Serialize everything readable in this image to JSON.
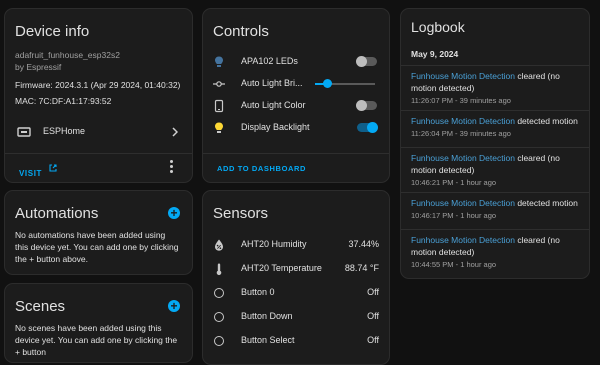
{
  "device": {
    "title": "Device info",
    "model": "adafruit_funhouse_esp32s2",
    "manufacturer": "by Espressif",
    "firmware": "Firmware: 2024.3.1 (Apr 29 2024, 01:40:32)",
    "mac": "MAC: 7C:DF:A1:17:93:52",
    "integration": "ESPHome",
    "visit_label": "VISIT"
  },
  "automations": {
    "title": "Automations",
    "empty_text": "No automations have been added using this device yet. You can add one by clicking the + button above."
  },
  "scenes": {
    "title": "Scenes",
    "empty_text": "No scenes have been added using this device yet. You can add one by clicking the + button"
  },
  "controls": {
    "title": "Controls",
    "items": [
      {
        "label": "APA102 LEDs",
        "type": "toggle",
        "on": false,
        "icon": "lightbulb-icon"
      },
      {
        "label": "Auto Light Bri...",
        "type": "slider",
        "level": 0.2,
        "icon": "brightness-slider-icon"
      },
      {
        "label": "Auto Light Color",
        "type": "toggle",
        "on": false,
        "icon": "tablet-icon"
      },
      {
        "label": "Display Backlight",
        "type": "toggle",
        "on": true,
        "icon": "lightbulb-on-icon"
      }
    ],
    "add_label": "ADD TO DASHBOARD"
  },
  "sensors": {
    "title": "Sensors",
    "items": [
      {
        "label": "AHT20 Humidity",
        "value": "37.44%",
        "icon": "water-percent-icon"
      },
      {
        "label": "AHT20 Temperature",
        "value": "88.74 °F",
        "icon": "thermometer-icon"
      },
      {
        "label": "Button 0",
        "value": "Off",
        "icon": "circle-icon"
      },
      {
        "label": "Button Down",
        "value": "Off",
        "icon": "circle-icon"
      },
      {
        "label": "Button Select",
        "value": "Off",
        "icon": "circle-icon"
      }
    ]
  },
  "logbook": {
    "title": "Logbook",
    "date": "May 9, 2024",
    "entries": [
      {
        "entity": "Funhouse Motion Detection",
        "action": " cleared (no motion detected)",
        "time": "11:26:07 PM - 39 minutes ago"
      },
      {
        "entity": "Funhouse Motion Detection",
        "action": " detected motion",
        "time": "11:26:04 PM - 39 minutes ago"
      },
      {
        "entity": "Funhouse Motion Detection",
        "action": " cleared (no motion detected)",
        "time": "10:46:21 PM - 1 hour ago"
      },
      {
        "entity": "Funhouse Motion Detection",
        "action": " detected motion",
        "time": "10:46:17 PM - 1 hour ago"
      },
      {
        "entity": "Funhouse Motion Detection",
        "action": " cleared (no motion detected)",
        "time": "10:44:55 PM - 1 hour ago"
      }
    ]
  },
  "colors": {
    "accent": "#03a9f4",
    "card_bg": "#1c1c1c",
    "page_bg": "#111111",
    "entity_link": "#4aa0d6",
    "bulb_on": "#fdd835",
    "bulb_off": "#44739e"
  }
}
